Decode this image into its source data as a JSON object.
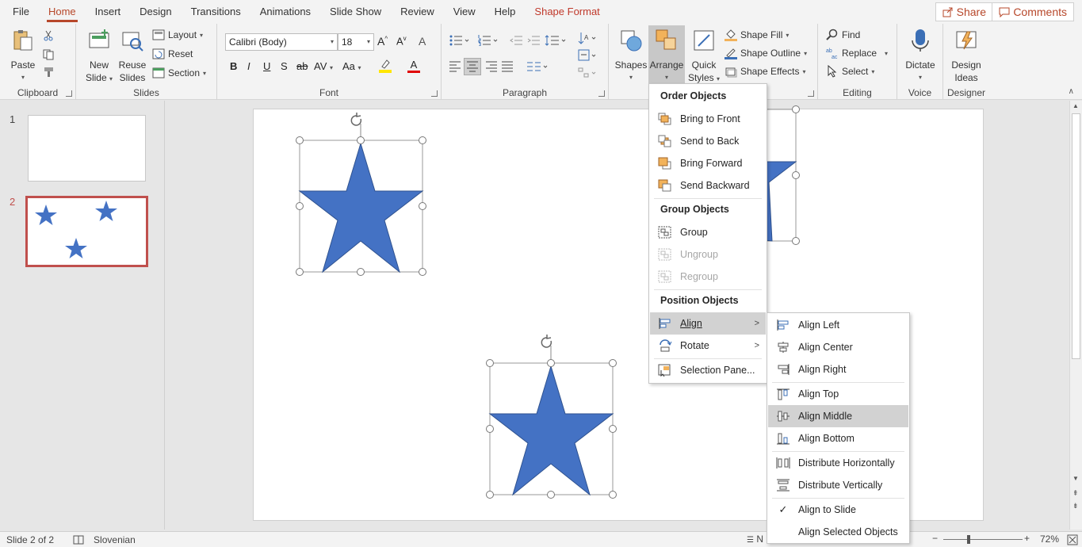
{
  "menu_tabs": [
    "File",
    "Home",
    "Insert",
    "Design",
    "Transitions",
    "Animations",
    "Slide Show",
    "Review",
    "View",
    "Help",
    "Shape Format"
  ],
  "share_label": "Share",
  "comments_label": "Comments",
  "ribbon": {
    "clipboard": {
      "label": "Clipboard",
      "paste": "Paste"
    },
    "slides": {
      "label": "Slides",
      "new_slide_1": "New",
      "new_slide_2": "Slide",
      "reuse_1": "Reuse",
      "reuse_2": "Slides",
      "layout": "Layout",
      "reset": "Reset",
      "section": "Section"
    },
    "font": {
      "label": "Font",
      "font_name": "Calibri (Body)",
      "font_size": "18"
    },
    "paragraph": {
      "label": "Paragraph"
    },
    "drawing": {
      "shapes": "Shapes",
      "arrange": "Arrange",
      "quick_1": "Quick",
      "quick_2": "Styles",
      "shape_fill": "Shape Fill",
      "shape_outline": "Shape Outline",
      "shape_effects": "Shape Effects"
    },
    "editing": {
      "label": "Editing",
      "find": "Find",
      "replace": "Replace",
      "select": "Select"
    },
    "voice": {
      "label": "Voice",
      "dictate": "Dictate"
    },
    "designer": {
      "label": "Designer",
      "design_1": "Design",
      "design_2": "Ideas"
    }
  },
  "slides": [
    {
      "number": "1"
    },
    {
      "number": "2"
    }
  ],
  "arrange_menu": {
    "order_header": "Order Objects",
    "bring_to_front": "Bring to Front",
    "send_to_back": "Send to Back",
    "bring_forward": "Bring Forward",
    "send_backward": "Send Backward",
    "group_header": "Group Objects",
    "group": "Group",
    "ungroup": "Ungroup",
    "regroup": "Regroup",
    "position_header": "Position Objects",
    "align": "Align",
    "rotate": "Rotate",
    "selection_pane": "Selection Pane..."
  },
  "align_menu": {
    "align_left": "Align Left",
    "align_center": "Align Center",
    "align_right": "Align Right",
    "align_top": "Align Top",
    "align_middle": "Align Middle",
    "align_bottom": "Align Bottom",
    "distribute_h": "Distribute Horizontally",
    "distribute_v": "Distribute Vertically",
    "align_to_slide": "Align to Slide",
    "align_selected": "Align Selected Objects"
  },
  "status": {
    "slide_info": "Slide 2 of 2",
    "language": "Slovenian",
    "notes": "N",
    "zoom": "72%"
  },
  "colors": {
    "accent": "#b7472a",
    "star_fill": "#4472c4",
    "star_stroke": "#2f528f"
  }
}
